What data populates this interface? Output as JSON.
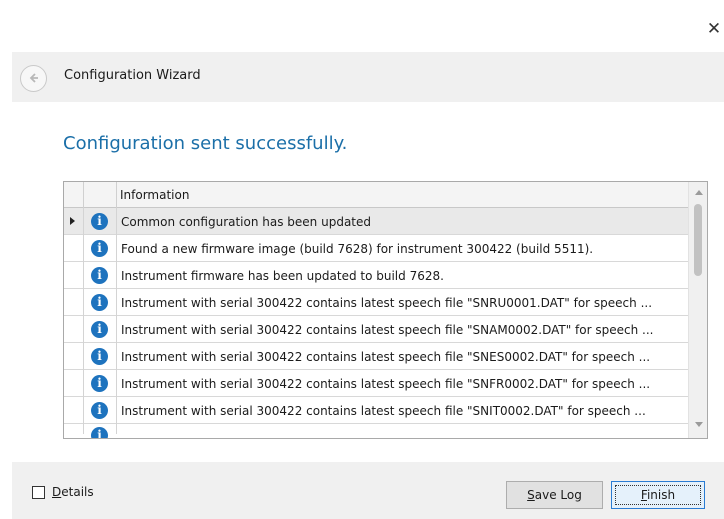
{
  "window": {
    "close_glyph": "✕"
  },
  "wizard": {
    "title": "Configuration Wizard"
  },
  "main": {
    "heading": "Configuration sent successfully."
  },
  "grid": {
    "column_header": "Information",
    "rows": [
      "Common configuration has been updated",
      "Found a new firmware image (build 7628) for instrument 300422 (build 5511).",
      "Instrument firmware has been updated to build 7628.",
      "Instrument with serial 300422 contains latest speech file \"SNRU0001.DAT\" for speech ...",
      "Instrument with serial 300422 contains latest speech file \"SNAM0002.DAT\" for speech ...",
      "Instrument with serial 300422 contains latest speech file \"SNES0002.DAT\" for speech ...",
      "Instrument with serial 300422 contains latest speech file \"SNFR0002.DAT\" for speech ...",
      "Instrument with serial 300422 contains latest speech file \"SNIT0002.DAT\" for speech ..."
    ],
    "icon": "info-icon",
    "selected_row": 0
  },
  "footer": {
    "details_label": "Details",
    "details_checked": false,
    "save_log_label": "Save Log",
    "finish_label": "Finish"
  },
  "colors": {
    "heading": "#1b6fa8",
    "info_icon": "#1e73be",
    "bars": "#f0f0f0"
  }
}
